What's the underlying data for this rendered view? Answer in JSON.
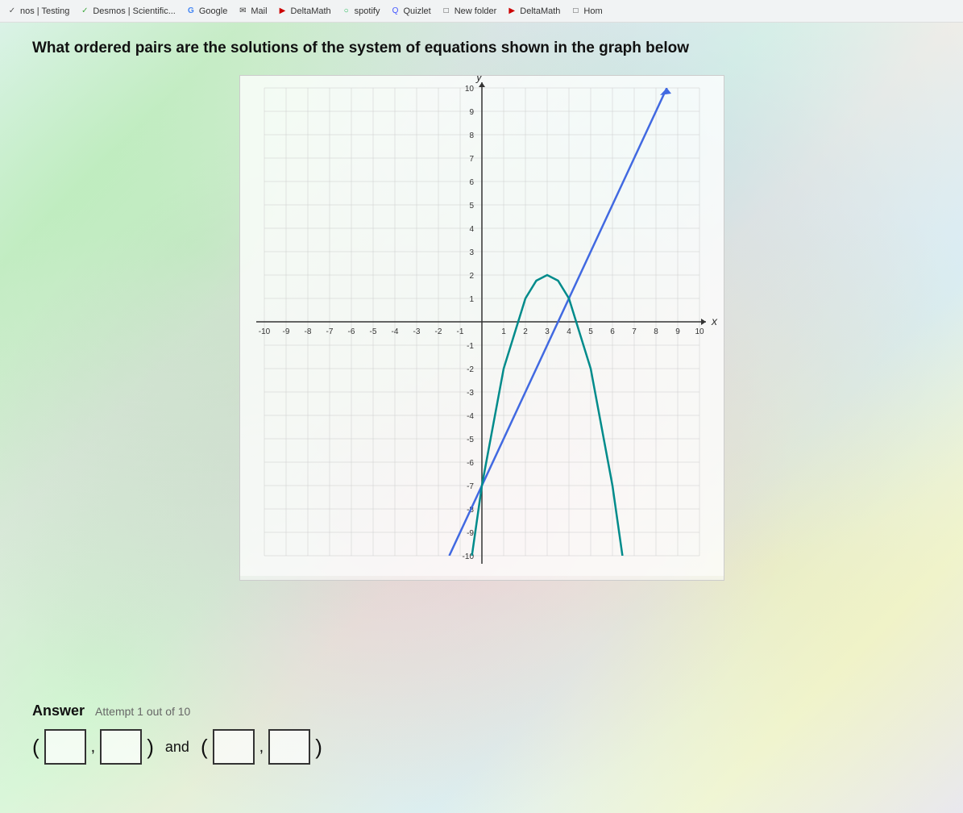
{
  "bookmarks": [
    {
      "label": "nos | Testing",
      "icon": "✓",
      "color": "#555"
    },
    {
      "label": "Desmos | Scientific...",
      "icon": "✓",
      "color": "#4a4"
    },
    {
      "label": "Google",
      "icon": "G",
      "color": "#4285f4"
    },
    {
      "label": "Mail",
      "icon": "✉",
      "color": "#555"
    },
    {
      "label": "DeltaMath",
      "icon": "▶",
      "color": "#cc0000"
    },
    {
      "label": "spotify",
      "icon": "○",
      "color": "#1db954"
    },
    {
      "label": "Quizlet",
      "icon": "Q",
      "color": "#4255ff"
    },
    {
      "label": "New folder",
      "icon": "□",
      "color": "#555"
    },
    {
      "label": "DeltaMath",
      "icon": "▶",
      "color": "#cc0000"
    },
    {
      "label": "Hom",
      "icon": "□",
      "color": "#555"
    }
  ],
  "question": {
    "text": "What ordered pairs are the solutions of the system of equations shown in the graph below"
  },
  "answer": {
    "label": "Answer",
    "attempt_text": "Attempt 1 out of 10",
    "and_text": "and",
    "box1_placeholder": "",
    "box2_placeholder": "",
    "box3_placeholder": "",
    "box4_placeholder": ""
  },
  "graph": {
    "x_min": -10,
    "x_max": 10,
    "y_min": -10,
    "y_max": 10,
    "x_label": "x",
    "y_label": "y"
  }
}
